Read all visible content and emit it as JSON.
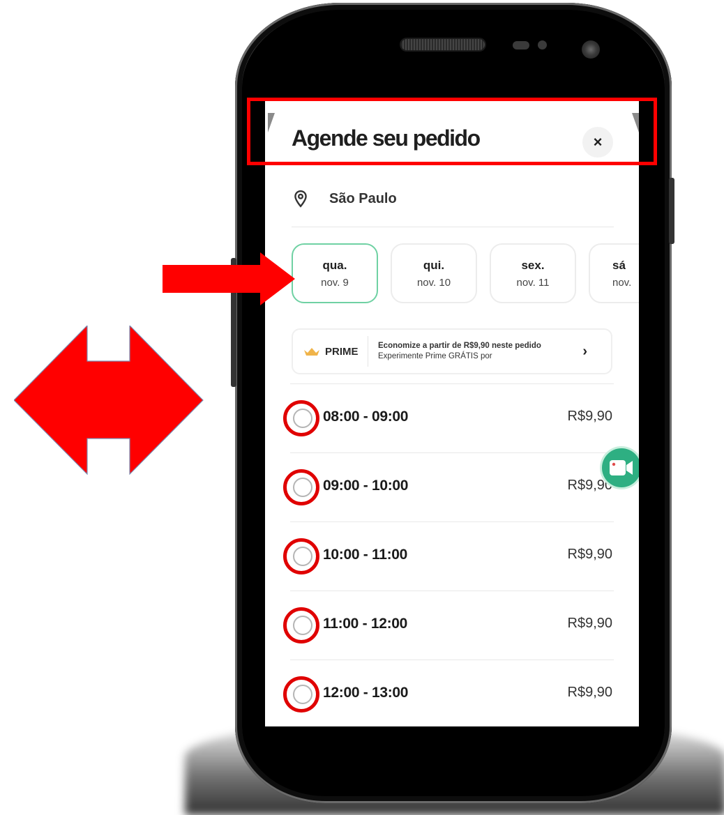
{
  "sheet": {
    "title": "Agende seu pedido",
    "close_label": "×"
  },
  "location": {
    "icon": "map-pin-icon",
    "city": "São Paulo"
  },
  "days": [
    {
      "name": "qua.",
      "date": "nov. 9",
      "selected": true
    },
    {
      "name": "qui.",
      "date": "nov. 10",
      "selected": false
    },
    {
      "name": "sex.",
      "date": "nov. 11",
      "selected": false
    },
    {
      "name": "sá",
      "date": "nov.",
      "selected": false
    }
  ],
  "prime": {
    "label": "PRIME",
    "bold_text": "Economize a partir de R$9,90 neste pedido",
    "text": "Experimente Prime GRÁTIS por",
    "chevron": "›"
  },
  "slots": [
    {
      "time": "08:00 - 09:00",
      "price": "R$9,90"
    },
    {
      "time": "09:00 - 10:00",
      "price": "R$9,90"
    },
    {
      "time": "10:00 - 11:00",
      "price": "R$9,90"
    },
    {
      "time": "11:00 - 12:00",
      "price": "R$9,90"
    },
    {
      "time": "12:00 - 13:00",
      "price": "R$9,90"
    }
  ],
  "colors": {
    "selected_border": "#6fd1a3",
    "video_button": "#2eaf82",
    "annotation": "#ff0000"
  }
}
